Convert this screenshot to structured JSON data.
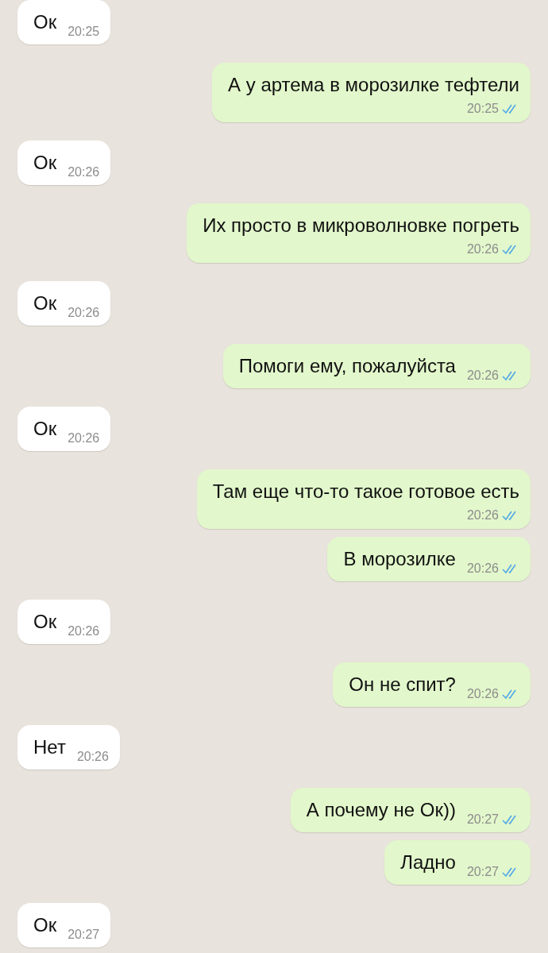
{
  "messages": [
    {
      "outgoing": false,
      "kind": "inline",
      "text": "Ок",
      "time": "20:25"
    },
    {
      "outgoing": true,
      "kind": "stacked",
      "text": "А у артема в морозилке тефтели",
      "time": "20:25",
      "read": true
    },
    {
      "outgoing": false,
      "kind": "inline",
      "text": "Ок",
      "time": "20:26"
    },
    {
      "outgoing": true,
      "kind": "stacked",
      "text": "Их просто в микроволновке погреть",
      "time": "20:26",
      "read": true
    },
    {
      "outgoing": false,
      "kind": "inline",
      "text": "Ок",
      "time": "20:26"
    },
    {
      "outgoing": true,
      "kind": "inline",
      "text": "Помоги ему, пожалуйста",
      "time": "20:26",
      "read": true
    },
    {
      "outgoing": false,
      "kind": "inline",
      "text": "Ок",
      "time": "20:26"
    },
    {
      "outgoing": true,
      "kind": "stacked",
      "text": "Там еще что-то такое готовое есть",
      "time": "20:26",
      "read": true
    },
    {
      "outgoing": true,
      "kind": "inline",
      "text": "В морозилке",
      "time": "20:26",
      "read": true
    },
    {
      "outgoing": false,
      "kind": "inline",
      "text": "Ок",
      "time": "20:26"
    },
    {
      "outgoing": true,
      "kind": "inline",
      "text": "Он не спит?",
      "time": "20:26",
      "read": true
    },
    {
      "outgoing": false,
      "kind": "inline",
      "text": "Нет",
      "time": "20:26"
    },
    {
      "outgoing": true,
      "kind": "inline",
      "text": "А почему не Ок))",
      "time": "20:27",
      "read": true
    },
    {
      "outgoing": true,
      "kind": "inline",
      "text": "Ладно",
      "time": "20:27",
      "read": true
    },
    {
      "outgoing": false,
      "kind": "inline",
      "text": "Ок",
      "time": "20:27"
    }
  ]
}
